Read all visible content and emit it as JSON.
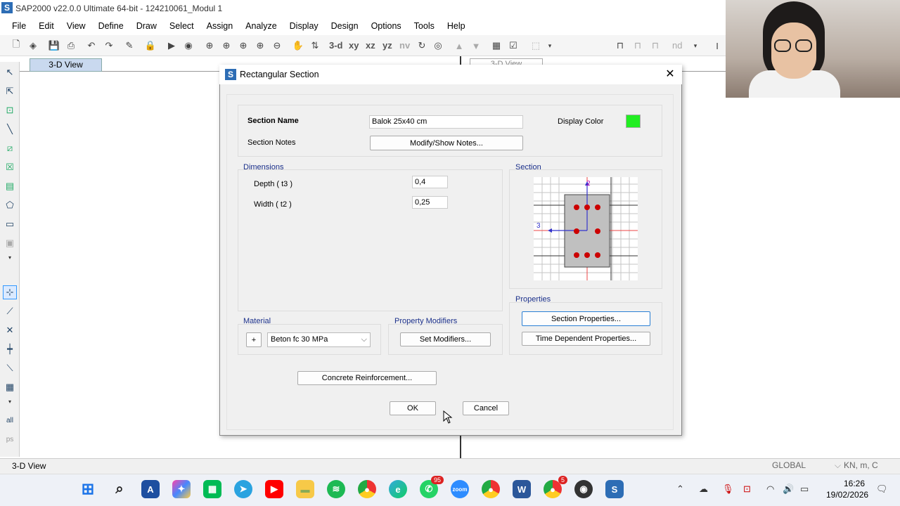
{
  "app": {
    "title": "SAP2000 v22.0.0 Ultimate 64-bit - 124210061_Modul 1",
    "icon_letter": "S"
  },
  "menu": [
    "File",
    "Edit",
    "View",
    "Define",
    "Draw",
    "Select",
    "Assign",
    "Analyze",
    "Display",
    "Design",
    "Options",
    "Tools",
    "Help"
  ],
  "toolbar": {
    "view_3d": "3-d",
    "view_xy": "xy",
    "view_xz": "xz",
    "view_yz": "yz",
    "view_nv": "nv",
    "nd_label": "nd"
  },
  "view_tabs": {
    "left": "3-D View",
    "right": "3-D View"
  },
  "dialog": {
    "title": "Rectangular Section",
    "section_name_label": "Section Name",
    "section_name_value": "Balok 25x40 cm",
    "section_notes_label": "Section Notes",
    "modify_notes_button": "Modify/Show Notes...",
    "display_color_label": "Display Color",
    "display_color": "#22ee22",
    "dimensions_label": "Dimensions",
    "depth_label": "Depth  ( t3 )",
    "depth_value": "0,4",
    "width_label": "Width  ( t2 )",
    "width_value": "0,25",
    "section_label": "Section",
    "section_axis_2": "2",
    "section_axis_3": "3",
    "properties_label": "Properties",
    "section_properties_button": "Section Properties...",
    "time_dependent_button": "Time Dependent Properties...",
    "material_label": "Material",
    "material_plus": "+",
    "material_value": "Beton fc 30 MPa",
    "property_modifiers_label": "Property Modifiers",
    "set_modifiers_button": "Set Modifiers...",
    "concrete_reinforcement_button": "Concrete Reinforcement...",
    "ok_button": "OK",
    "cancel_button": "Cancel"
  },
  "status": {
    "view": "3-D View",
    "coord_system": "GLOBAL",
    "units": "KN, m, C"
  },
  "taskbar": {
    "whatsapp_badge": "95",
    "chrome2_badge": "5",
    "time": "16:26",
    "date": "19/02/2026"
  }
}
